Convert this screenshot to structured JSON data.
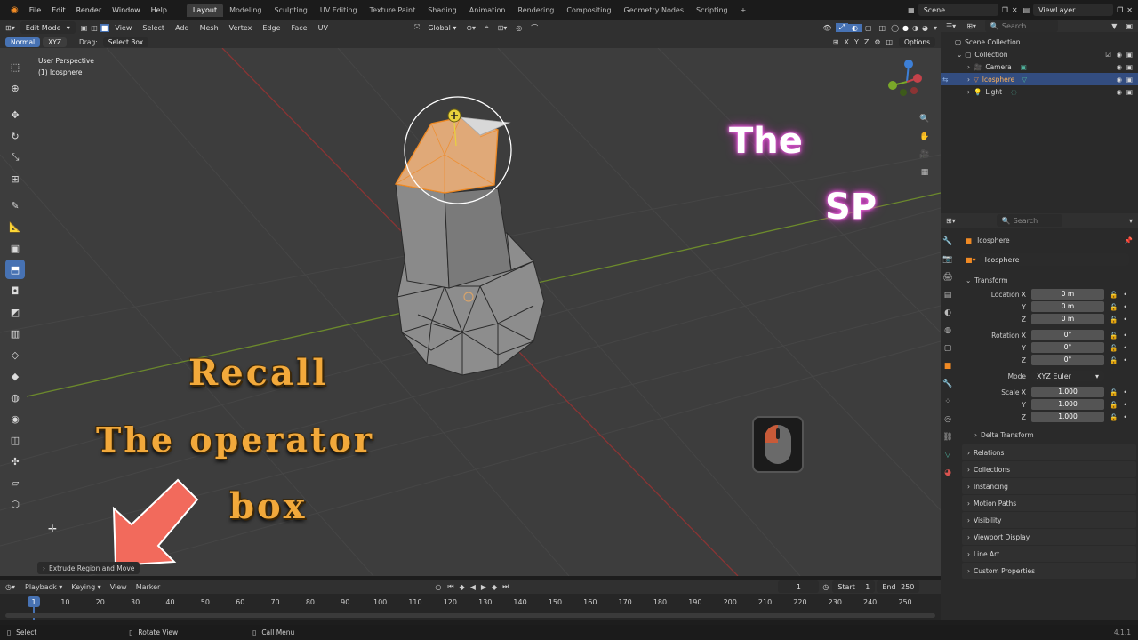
{
  "menus": [
    "File",
    "Edit",
    "Render",
    "Window",
    "Help"
  ],
  "workspaces": [
    "Layout",
    "Modeling",
    "Sculpting",
    "UV Editing",
    "Texture Paint",
    "Shading",
    "Animation",
    "Rendering",
    "Compositing",
    "Geometry Nodes",
    "Scripting"
  ],
  "active_workspace": "Layout",
  "scene_name": "Scene",
  "view_layer": "ViewLayer",
  "viewport_header": {
    "mode": "Edit Mode",
    "menus": [
      "View",
      "Select",
      "Add",
      "Mesh",
      "Vertex",
      "Edge",
      "Face",
      "UV"
    ],
    "orientation": "Global",
    "options": "Options"
  },
  "viewport_subheader": {
    "normal": "Normal",
    "xyz": "XYZ",
    "drag_label": "Drag:",
    "drag_value": "Select Box"
  },
  "gizmo_axes": [
    "X",
    "Y",
    "Z"
  ],
  "viewport_info": {
    "line1": "User Perspective",
    "line2": "(1) Icosphere"
  },
  "overlay_text": {
    "recall": "Recall",
    "operator": "The operator",
    "box": "box",
    "the": "The",
    "sp": "SP"
  },
  "last_operator": "Extrude Region and Move",
  "outliner": {
    "search_placeholder": "Search",
    "root": "Scene Collection",
    "collection": "Collection",
    "items": [
      "Camera",
      "Icosphere",
      "Light"
    ]
  },
  "properties": {
    "search_placeholder": "Search",
    "object_name": "Icosphere",
    "object_field": "Icosphere",
    "transform_header": "Transform",
    "location_label": "Location X",
    "location": [
      "0 m",
      "0 m",
      "0 m"
    ],
    "rotation_label": "Rotation X",
    "rotation": [
      "0°",
      "0°",
      "0°"
    ],
    "axis_y": "Y",
    "axis_z": "Z",
    "mode_label": "Mode",
    "mode_value": "XYZ Euler",
    "scale_label": "Scale X",
    "scale": [
      "1.000",
      "1.000",
      "1.000"
    ],
    "delta_transform": "Delta Transform",
    "panels": [
      "Relations",
      "Collections",
      "Instancing",
      "Motion Paths",
      "Visibility",
      "Viewport Display",
      "Line Art",
      "Custom Properties"
    ]
  },
  "timeline": {
    "menus": [
      "Playback",
      "Keying",
      "View",
      "Marker"
    ],
    "current_frame": "1",
    "start_label": "Start",
    "start": "1",
    "end_label": "End",
    "end": "250",
    "ruler": [
      "1",
      "10",
      "20",
      "30",
      "40",
      "50",
      "60",
      "70",
      "80",
      "90",
      "100",
      "110",
      "120",
      "130",
      "140",
      "150",
      "160",
      "170",
      "180",
      "190",
      "200",
      "210",
      "220",
      "230",
      "240",
      "250"
    ]
  },
  "statusbar": {
    "select": "Select",
    "rotate": "Rotate View",
    "call_menu": "Call Menu",
    "version": "4.1.1"
  }
}
